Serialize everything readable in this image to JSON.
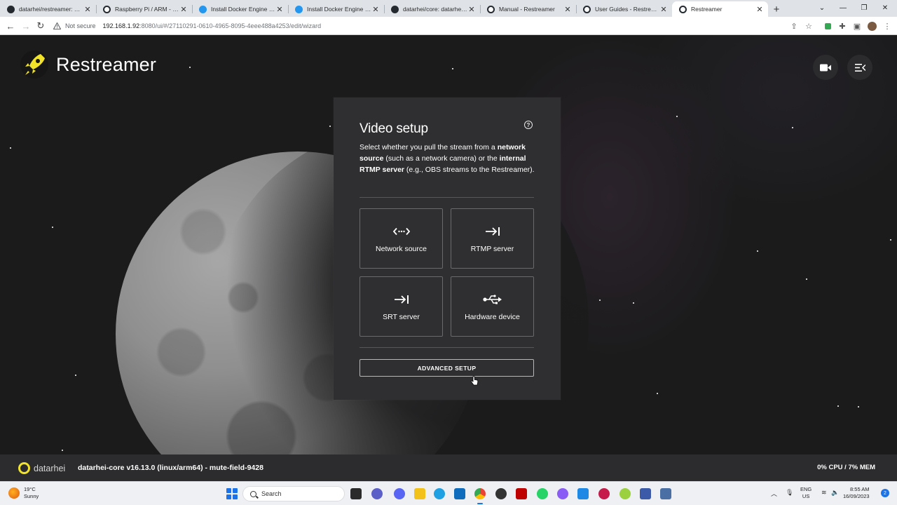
{
  "browser": {
    "tabs": [
      {
        "title": "datarhei/restreamer: The R",
        "icon": "github-icon"
      },
      {
        "title": "Raspberry Pi / ARM - Resti",
        "icon": "restreamer-icon"
      },
      {
        "title": "Install Docker Engine on D",
        "icon": "docker-icon"
      },
      {
        "title": "Install Docker Engine on D",
        "icon": "docker-icon"
      },
      {
        "title": "datarhei/core: datarhei Co",
        "icon": "github-icon"
      },
      {
        "title": "Manual - Restreamer",
        "icon": "restreamer-icon"
      },
      {
        "title": "User Guides - Restreamer",
        "icon": "restreamer-icon"
      },
      {
        "title": "Restreamer",
        "icon": "restreamer-icon"
      }
    ],
    "security_label": "Not secure",
    "url_host": "192.168.1.92",
    "url_rest": ":8080/ui/#/27110291-0610-4965-8095-4eee488a4253/edit/wizard"
  },
  "app": {
    "name": "Restreamer",
    "wizard": {
      "title": "Video setup",
      "desc_1": "Select whether you pull the stream from a ",
      "desc_b1": "network source",
      "desc_2": " (such as a network camera) or the ",
      "desc_b2": "internal RTMP server",
      "desc_3": " (e.g., OBS streams to the Restreamer).",
      "sources": [
        {
          "label": "Network source",
          "icon": "network-icon"
        },
        {
          "label": "RTMP server",
          "icon": "arrow-to-line-icon"
        },
        {
          "label": "SRT server",
          "icon": "arrow-to-line-icon"
        },
        {
          "label": "Hardware device",
          "icon": "usb-icon"
        }
      ],
      "advanced_label": "ADVANCED SETUP"
    },
    "footer": {
      "brand_a": "data",
      "brand_b": "rhei",
      "core_info": "datarhei-core v16.13.0 (linux/arm64) - mute-field-9428",
      "usage": "0% CPU / 7% MEM"
    },
    "colors": {
      "accent": "#f1e32a",
      "panel": "#2f2f31",
      "background": "#1b1b1c"
    }
  },
  "taskbar": {
    "weather_temp": "19°C",
    "weather_desc": "Sunny",
    "search_label": "Search",
    "lang_1": "ENG",
    "lang_2": "US",
    "time": "8:55 AM",
    "date": "16/09/2023",
    "notifications": "2"
  }
}
